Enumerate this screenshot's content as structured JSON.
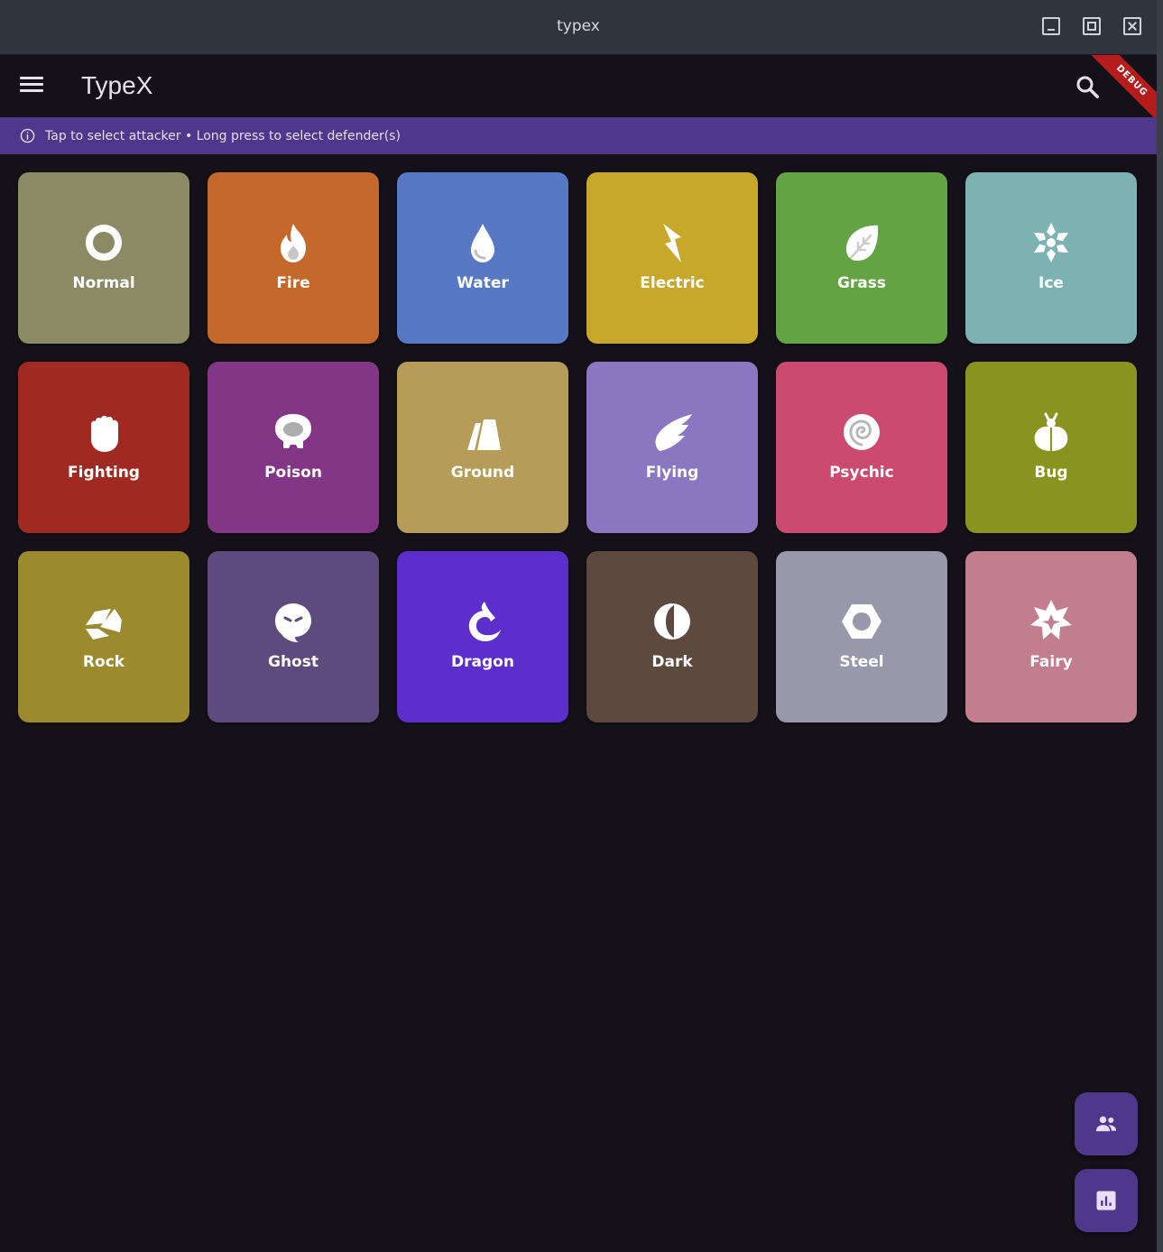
{
  "window": {
    "title": "typex"
  },
  "appbar": {
    "title": "TypeX",
    "debug_banner": "DEBUG"
  },
  "info_banner": {
    "text": "Tap to select attacker • Long press to select defender(s)"
  },
  "types": [
    {
      "label": "Normal",
      "color": "#8a8a65",
      "icon": "ring-icon"
    },
    {
      "label": "Fire",
      "color": "#c4692b",
      "icon": "flame-icon"
    },
    {
      "label": "Water",
      "color": "#5878c3",
      "icon": "water-drop-icon"
    },
    {
      "label": "Electric",
      "color": "#c8a82b",
      "icon": "lightning-icon"
    },
    {
      "label": "Grass",
      "color": "#63a344",
      "icon": "leaf-icon"
    },
    {
      "label": "Ice",
      "color": "#7eb1b2",
      "icon": "snowflake-icon"
    },
    {
      "label": "Fighting",
      "color": "#a02a22",
      "icon": "fist-icon"
    },
    {
      "label": "Poison",
      "color": "#833586",
      "icon": "skull-bubble-icon"
    },
    {
      "label": "Ground",
      "color": "#b69c59",
      "icon": "mountain-icon"
    },
    {
      "label": "Flying",
      "color": "#8a77c2",
      "icon": "wing-icon"
    },
    {
      "label": "Psychic",
      "color": "#cc4a70",
      "icon": "spiral-icon"
    },
    {
      "label": "Bug",
      "color": "#89931f",
      "icon": "beetle-icon"
    },
    {
      "label": "Rock",
      "color": "#9c8a2f",
      "icon": "rock-icon"
    },
    {
      "label": "Ghost",
      "color": "#5e4b7d",
      "icon": "ghost-icon"
    },
    {
      "label": "Dragon",
      "color": "#5c2fcd",
      "icon": "dragon-icon"
    },
    {
      "label": "Dark",
      "color": "#5c4a3f",
      "icon": "half-moon-icon"
    },
    {
      "label": "Steel",
      "color": "#9898aa",
      "icon": "hex-nut-icon"
    },
    {
      "label": "Fairy",
      "color": "#c27d8f",
      "icon": "sparkle-icon"
    }
  ],
  "fabs": [
    {
      "icon": "people-icon"
    },
    {
      "icon": "bar-chart-icon"
    }
  ]
}
